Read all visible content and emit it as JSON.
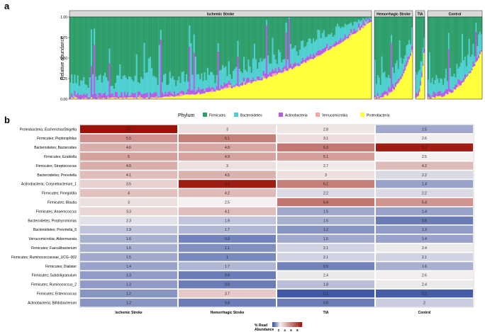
{
  "panel_a": {
    "letter": "a",
    "ylabel": "Relative abundance",
    "yticks": [
      "0.00",
      "0.25",
      "0.50",
      "0.75",
      "1.00"
    ],
    "facets": [
      "Ischemic Stroke",
      "Hemorrhagic Stroke",
      "TIA",
      "Control"
    ]
  },
  "panel_b": {
    "letter": "b",
    "legend_title": "Phylum",
    "colorbar_title_1": "% Read",
    "colorbar_title_2": "Abundance",
    "colorbar_ticks": [
      "2",
      "4",
      "6",
      "8"
    ]
  },
  "colors": {
    "Firmicutes": "#2e9e6b",
    "Bacteroidetes": "#4ecfd0",
    "Actinobacteria": "#b65de8",
    "Verrucomicrobia": "#f2a6a6",
    "Proteobacteria": "#ffff3a",
    "heat_low": "#3c55a4",
    "heat_mid": "#f4f0f0",
    "heat_high": "#9b1208"
  },
  "chart_data": [
    {
      "type": "bar",
      "stacked": true,
      "ylabel": "Relative abundance",
      "ylim": [
        0,
        1
      ],
      "legend_title": "Phylum",
      "legend_position": "bottom",
      "series_order": [
        "Firmicutes",
        "Bacteroidetes",
        "Actinobacteria",
        "Verrucomicrobia",
        "Proteobacteria"
      ],
      "facets": [
        {
          "name": "Ischemic Stroke",
          "n_samples": 200
        },
        {
          "name": "Hemorrhagic Stroke",
          "n_samples": 28
        },
        {
          "name": "TIA",
          "n_samples": 8
        },
        {
          "name": "Control",
          "n_samples": 40
        }
      ]
    },
    {
      "type": "heatmap",
      "columns": [
        "Ischemic Stroke",
        "Hemorrhagic Stroke",
        "TIA",
        "Control"
      ],
      "rows": [
        "Proteobacteria; Escherichia/Shigella",
        "Firmicutes; Peptoniphilus",
        "Bacteroidetes; Bacteroides",
        "Firmicutes; Ezakiella",
        "Firmicutes; Streptococcus",
        "Bacteroidetes; Prevotella",
        "Actinobacteria; Corynebacterium_1",
        "Firmicutes; Finegoldia",
        "Firmicutes; Blautia",
        "Firmicutes; Anaerococcus",
        "Bacteroidetes; Porphyromonas",
        "Bacteroidetes; Prevotella_6",
        "Verrucomicrobia; Akkermansia",
        "Firmicutes; Faecalibacterium",
        "Firmicutes; Ruminococcaceae_UCG−002",
        "Firmicutes; Dialister",
        "Firmicutes; Subdoligranulum",
        "Firmicutes; Ruminococcus_2",
        "Firmicutes; Enterococcus",
        "Actinobacteria; Bifidobacterium"
      ],
      "values": [
        [
          9.5,
          3,
          2.8,
          1.5
        ],
        [
          5.5,
          6.1,
          3.1,
          2.6
        ],
        [
          4.6,
          4.8,
          6.3,
          9.2
        ],
        [
          5,
          4.9,
          5.1,
          2.5
        ],
        [
          4.6,
          3,
          2.7,
          4.2
        ],
        [
          4.1,
          4.5,
          3,
          2.2
        ],
        [
          3.5,
          9.2,
          6.1,
          1.4
        ],
        [
          4,
          4.2,
          2.2,
          2.2
        ],
        [
          3,
          2.5,
          6.4,
          5.4
        ],
        [
          3.3,
          4.1,
          1.5,
          1.4
        ],
        [
          2.3,
          1.9,
          1.6,
          0.8
        ],
        [
          1.9,
          1.7,
          1.2,
          1.3
        ],
        [
          1.6,
          0.9,
          1.5,
          1.4
        ],
        [
          1.6,
          1.1,
          2.1,
          2.4
        ],
        [
          1.5,
          1,
          2.1,
          2.1
        ],
        [
          1.4,
          1.7,
          0.9,
          1.6
        ],
        [
          1.3,
          0.8,
          2.4,
          2.6
        ],
        [
          1.3,
          0.8,
          1.8,
          2.4
        ],
        [
          1.2,
          3.7,
          0.1,
          0.2
        ],
        [
          1.2,
          0.8,
          0.8,
          2
        ]
      ],
      "colorbar_title": "% Read Abundance",
      "colorbar_ticks": [
        2,
        4,
        6,
        8
      ],
      "colorbar_range": [
        0,
        9.5
      ]
    }
  ]
}
